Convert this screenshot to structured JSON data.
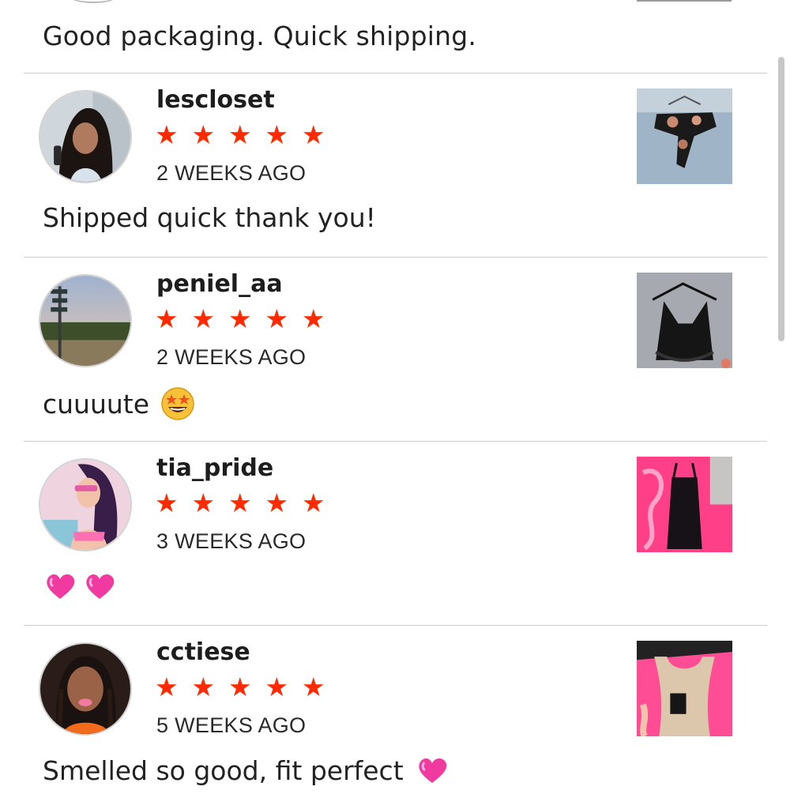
{
  "previous_review": {
    "comment": "Good packaging. Quick shipping."
  },
  "reviews": [
    {
      "username": "lescloset",
      "rating": 5,
      "stars": [
        "★",
        "★",
        "★",
        "★",
        "★"
      ],
      "time": "2 WEEKS AGO",
      "comment": "Shipped quick thank you!"
    },
    {
      "username": "peniel_aa",
      "rating": 5,
      "stars": [
        "★",
        "★",
        "★",
        "★",
        "★"
      ],
      "time": "2 WEEKS AGO",
      "comment": "cuuuute",
      "emoji": "star-struck-emoji"
    },
    {
      "username": "tia_pride",
      "rating": 5,
      "stars": [
        "★",
        "★",
        "★",
        "★",
        "★"
      ],
      "time": "3 WEEKS AGO",
      "comment": "",
      "emoji": "two-heart-emojis"
    },
    {
      "username": "cctiese",
      "rating": 5,
      "stars": [
        "★",
        "★",
        "★",
        "★",
        "★"
      ],
      "time": "5 WEEKS AGO",
      "comment": "Smelled so good, fit perfect",
      "emoji": "heart-emoji"
    }
  ],
  "colors": {
    "star": "#ff2a00",
    "divider": "#cfcfcf",
    "text": "#222222"
  }
}
